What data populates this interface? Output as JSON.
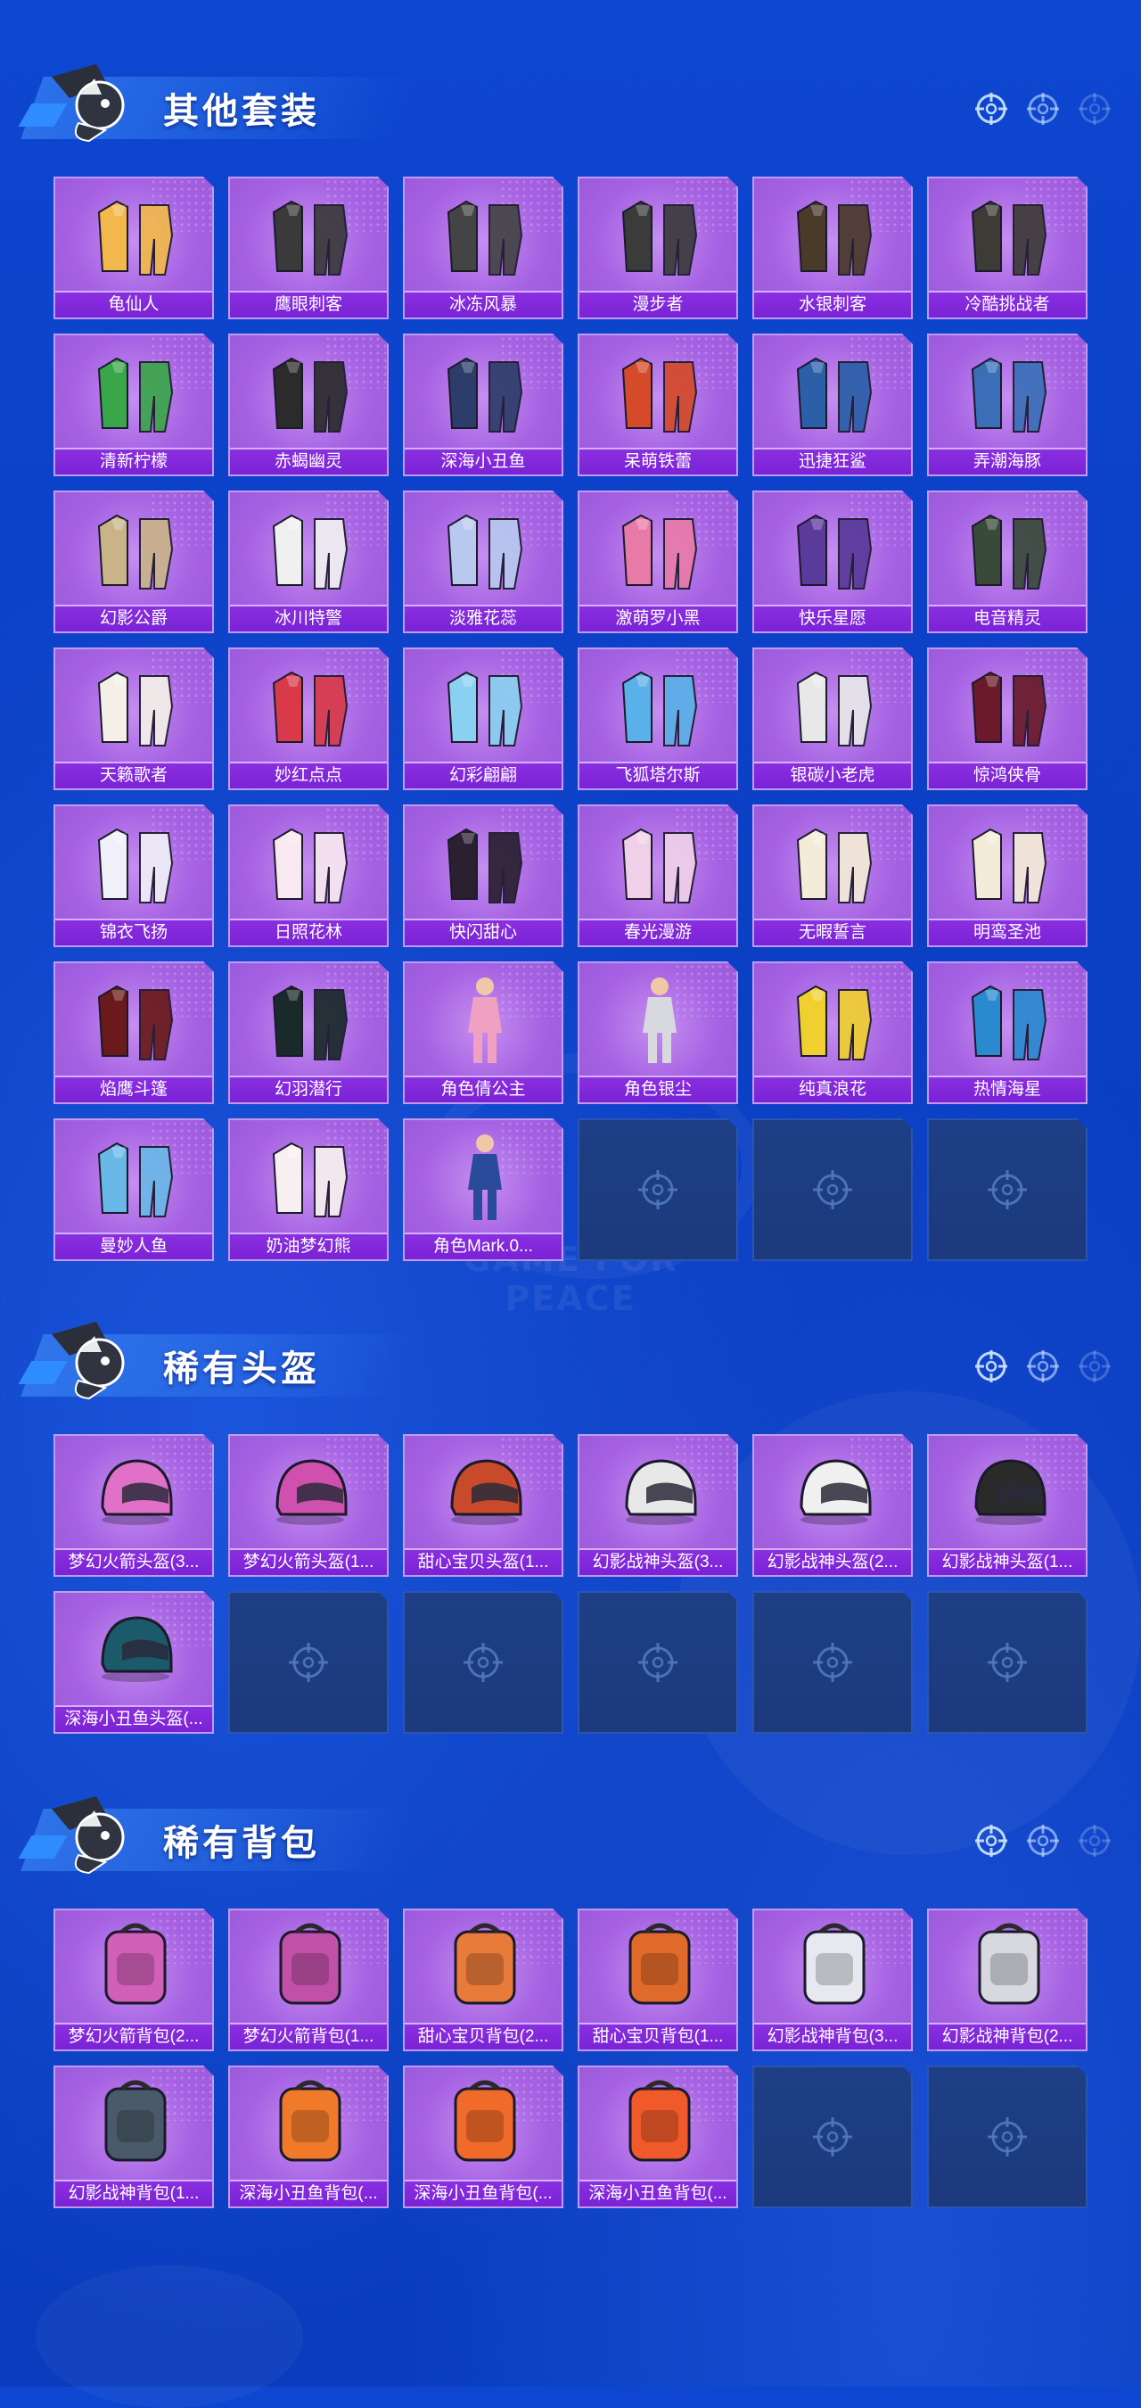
{
  "sections": [
    {
      "title": "其他套装",
      "icons": [
        "target-icon",
        "target-icon",
        "target-icon"
      ],
      "items": [
        {
          "label": "龟仙人",
          "icon": "outfit-icon",
          "color": "#f2b84b"
        },
        {
          "label": "鹰眼刺客",
          "icon": "outfit-icon",
          "color": "#3a3a3a"
        },
        {
          "label": "冰冻风暴",
          "icon": "outfit-icon",
          "color": "#444444"
        },
        {
          "label": "漫步者",
          "icon": "outfit-icon",
          "color": "#3b3b3b"
        },
        {
          "label": "水银刺客",
          "icon": "outfit-icon",
          "color": "#4a3a2a"
        },
        {
          "label": "冷酷挑战者",
          "icon": "outfit-icon",
          "color": "#3d3b36"
        },
        {
          "label": "清新柠檬",
          "icon": "outfit-icon",
          "color": "#3aa64a"
        },
        {
          "label": "赤蝎幽灵",
          "icon": "outfit-icon",
          "color": "#2b2b2b"
        },
        {
          "label": "深海小丑鱼",
          "icon": "outfit-icon",
          "color": "#2d3d6b"
        },
        {
          "label": "呆萌铁蕾",
          "icon": "outfit-icon",
          "color": "#d44a2a"
        },
        {
          "label": "迅捷狂鲨",
          "icon": "outfit-icon",
          "color": "#2b5fa8"
        },
        {
          "label": "弄潮海豚",
          "icon": "outfit-icon",
          "color": "#3a6fb8"
        },
        {
          "label": "幻影公爵",
          "icon": "outfit-icon",
          "color": "#c9b48a"
        },
        {
          "label": "冰川特警",
          "icon": "outfit-icon",
          "color": "#f0f0f0"
        },
        {
          "label": "淡雅花蕊",
          "icon": "outfit-icon",
          "color": "#b8c8ef"
        },
        {
          "label": "激萌罗小黑",
          "icon": "outfit-icon",
          "color": "#e87aa8"
        },
        {
          "label": "快乐星愿",
          "icon": "outfit-icon",
          "color": "#5a3a9a"
        },
        {
          "label": "电音精灵",
          "icon": "outfit-icon",
          "color": "#3a4a3a"
        },
        {
          "label": "天籁歌者",
          "icon": "outfit-icon",
          "color": "#f4f0e8"
        },
        {
          "label": "妙红点点",
          "icon": "outfit-icon",
          "color": "#d83a4a"
        },
        {
          "label": "幻彩翩翩",
          "icon": "outfit-icon",
          "color": "#8ad0f0"
        },
        {
          "label": "飞狐塔尔斯",
          "icon": "outfit-icon",
          "color": "#5ab0e8"
        },
        {
          "label": "银碳小老虎",
          "icon": "outfit-icon",
          "color": "#e8e8e8"
        },
        {
          "label": "惊鸿侠骨",
          "icon": "outfit-icon",
          "color": "#6a1a2a"
        },
        {
          "label": "锦衣飞扬",
          "icon": "outfit-icon",
          "color": "#f0f0f8"
        },
        {
          "label": "日照花林",
          "icon": "outfit-icon",
          "color": "#f8e8f0"
        },
        {
          "label": "快闪甜心",
          "icon": "outfit-icon",
          "color": "#2a2030"
        },
        {
          "label": "春光漫游",
          "icon": "outfit-icon",
          "color": "#f0d0e8"
        },
        {
          "label": "无暇誓言",
          "icon": "outfit-icon",
          "color": "#f4ecd8"
        },
        {
          "label": "明鸾圣池",
          "icon": "outfit-icon",
          "color": "#f4ecd8"
        },
        {
          "label": "焰鹰斗篷",
          "icon": "outfit-icon",
          "color": "#6a1a1a"
        },
        {
          "label": "幻羽潜行",
          "icon": "outfit-icon",
          "color": "#1a2a2a"
        },
        {
          "label": "角色倩公主",
          "icon": "character-icon",
          "color": "#f0a0c0"
        },
        {
          "label": "角色银尘",
          "icon": "character-icon",
          "color": "#d8d8e0"
        },
        {
          "label": "纯真浪花",
          "icon": "outfit-icon",
          "color": "#f0d030"
        },
        {
          "label": "热情海星",
          "icon": "outfit-icon",
          "color": "#2a8ad0"
        },
        {
          "label": "曼妙人鱼",
          "icon": "outfit-icon",
          "color": "#6ab8e8"
        },
        {
          "label": "奶油梦幻熊",
          "icon": "outfit-icon",
          "color": "#f8f0f0"
        },
        {
          "label": "角色Mark.0...",
          "icon": "character-icon",
          "color": "#2a4a9a"
        }
      ],
      "empty_slots": 3
    },
    {
      "title": "稀有头盔",
      "icons": [
        "target-icon",
        "target-icon",
        "target-icon"
      ],
      "items": [
        {
          "label": "梦幻火箭头盔(3...",
          "icon": "helmet-icon",
          "color": "#e070c8"
        },
        {
          "label": "梦幻火箭头盔(1...",
          "icon": "helmet-icon",
          "color": "#d050b0"
        },
        {
          "label": "甜心宝贝头盔(1...",
          "icon": "helmet-icon",
          "color": "#c84a2a"
        },
        {
          "label": "幻影战神头盔(3...",
          "icon": "helmet-icon",
          "color": "#e8e8e8"
        },
        {
          "label": "幻影战神头盔(2...",
          "icon": "helmet-icon",
          "color": "#f0f0f0"
        },
        {
          "label": "幻影战神头盔(1...",
          "icon": "helmet-icon",
          "color": "#2a2a2a"
        },
        {
          "label": "深海小丑鱼头盔(...",
          "icon": "helmet-icon",
          "color": "#1a5a6a"
        }
      ],
      "empty_slots": 5
    },
    {
      "title": "稀有背包",
      "icons": [
        "target-icon",
        "target-icon",
        "target-icon"
      ],
      "items": [
        {
          "label": "梦幻火箭背包(2...",
          "icon": "backpack-icon",
          "color": "#d060b8"
        },
        {
          "label": "梦幻火箭背包(1...",
          "icon": "backpack-icon",
          "color": "#c050a8"
        },
        {
          "label": "甜心宝贝背包(2...",
          "icon": "backpack-icon",
          "color": "#e87a3a"
        },
        {
          "label": "甜心宝贝背包(1...",
          "icon": "backpack-icon",
          "color": "#e06a2a"
        },
        {
          "label": "幻影战神背包(3...",
          "icon": "backpack-icon",
          "color": "#e8e8f0"
        },
        {
          "label": "幻影战神背包(2...",
          "icon": "backpack-icon",
          "color": "#d8d8e0"
        },
        {
          "label": "幻影战神背包(1...",
          "icon": "backpack-icon",
          "color": "#4a5a6a"
        },
        {
          "label": "深海小丑鱼背包(...",
          "icon": "backpack-icon",
          "color": "#f07a2a"
        },
        {
          "label": "深海小丑鱼背包(...",
          "icon": "backpack-icon",
          "color": "#f06a2a"
        },
        {
          "label": "深海小丑鱼背包(...",
          "icon": "backpack-icon",
          "color": "#f05a2a"
        }
      ],
      "empty_slots": 2
    }
  ],
  "watermark": "GAME FOR PEACE"
}
